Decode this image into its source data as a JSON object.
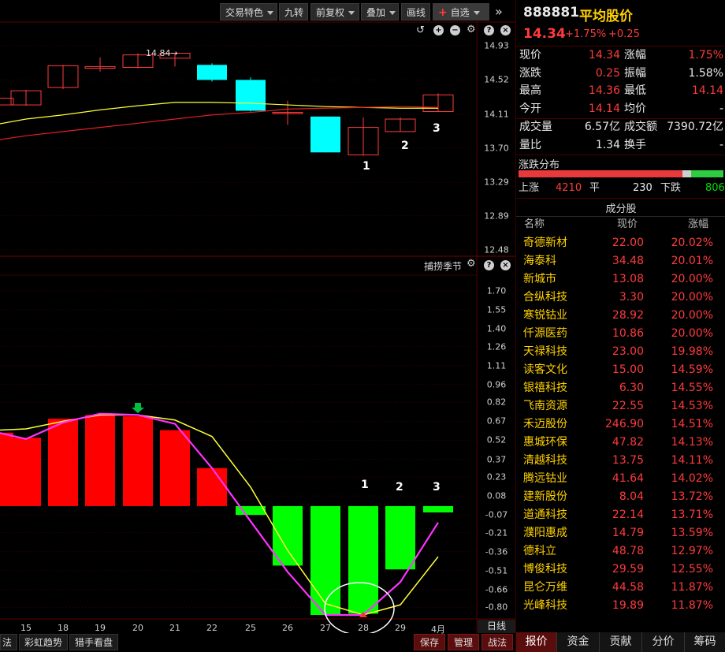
{
  "toolbar": {
    "items": [
      "交易特色",
      "九转",
      "前复权",
      "叠加",
      "画线",
      "自选"
    ],
    "more": "»"
  },
  "price_axis": [
    "14.93",
    "14.52",
    "14.11",
    "13.70",
    "13.29",
    "12.89",
    "12.48"
  ],
  "candle_annotation": "14.84→",
  "candle_markers": [
    "1",
    "2",
    "3"
  ],
  "indicator": {
    "title": "捕捞季节",
    "axis": [
      "1.70",
      "1.55",
      "1.40",
      "1.26",
      "1.11",
      "0.96",
      "0.82",
      "0.67",
      "0.52",
      "0.37",
      "0.23",
      "0.08",
      "-0.07",
      "-0.21",
      "-0.36",
      "-0.51",
      "-0.66",
      "-0.80"
    ],
    "markers": [
      "1",
      "2",
      "3"
    ]
  },
  "x_axis": [
    "15",
    "18",
    "19",
    "20",
    "21",
    "22",
    "25",
    "26",
    "27",
    "28",
    "29",
    "4月"
  ],
  "x_axis_right": "日线",
  "bottom_tabs": [
    "法",
    "彩虹趋势",
    "猎手看盘"
  ],
  "bottom_buttons": [
    "保存",
    "管理",
    "战法"
  ],
  "quote": {
    "code": "888881",
    "name": "平均股价",
    "price": "14.34",
    "change_pct": "+1.75%",
    "change": "+0.25",
    "rows": [
      {
        "l1": "现价",
        "v1": "14.34",
        "l2": "涨幅",
        "v2": "1.75%"
      },
      {
        "l1": "涨跌",
        "v1": "0.25",
        "l2": "振幅",
        "v2": "1.58%"
      },
      {
        "l1": "最高",
        "v1": "14.36",
        "l2": "最低",
        "v2": "14.14"
      },
      {
        "l1": "今开",
        "v1": "14.14",
        "l2": "均价",
        "v2": "-"
      }
    ],
    "rows2": [
      {
        "l1": "成交量",
        "v1": "6.57亿",
        "l2": "成交额",
        "v2": "7390.72亿"
      },
      {
        "l1": "量比",
        "v1": "1.34",
        "l2": "换手",
        "v2": "-"
      }
    ]
  },
  "distribution": {
    "title": "涨跌分布",
    "up_label": "上涨",
    "up": "4210",
    "flat_label": "平",
    "flat": "230",
    "down_label": "下跌",
    "down": "806",
    "up_ratio": 0.8,
    "flat_ratio": 0.044,
    "down_ratio": 0.156
  },
  "components": {
    "title": "成分股",
    "headers": [
      "名称",
      "现价",
      "涨幅"
    ],
    "rows": [
      [
        "奇德新材",
        "22.00",
        "20.02%"
      ],
      [
        "海泰科",
        "34.48",
        "20.01%"
      ],
      [
        "新城市",
        "13.08",
        "20.00%"
      ],
      [
        "合纵科技",
        "3.30",
        "20.00%"
      ],
      [
        "寒锐钴业",
        "28.92",
        "20.00%"
      ],
      [
        "仟源医药",
        "10.86",
        "20.00%"
      ],
      [
        "天禄科技",
        "23.00",
        "19.98%"
      ],
      [
        "读客文化",
        "15.00",
        "14.59%"
      ],
      [
        "银禧科技",
        "6.30",
        "14.55%"
      ],
      [
        "飞南资源",
        "22.55",
        "14.53%"
      ],
      [
        "禾迈股份",
        "246.90",
        "14.51%"
      ],
      [
        "惠城环保",
        "47.82",
        "14.13%"
      ],
      [
        "清越科技",
        "13.75",
        "14.11%"
      ],
      [
        "腾远钴业",
        "41.64",
        "14.02%"
      ],
      [
        "建新股份",
        "8.04",
        "13.72%"
      ],
      [
        "道通科技",
        "22.14",
        "13.71%"
      ],
      [
        "濮阳惠成",
        "14.79",
        "13.59%"
      ],
      [
        "德科立",
        "48.78",
        "12.97%"
      ],
      [
        "博俊科技",
        "29.59",
        "12.55%"
      ],
      [
        "昆仑万维",
        "44.58",
        "11.87%"
      ],
      [
        "光峰科技",
        "19.89",
        "11.87%"
      ]
    ]
  },
  "right_tabs": [
    "报价",
    "资金",
    "贡献",
    "分价",
    "筹码"
  ],
  "colors": {
    "up": "#ff3b3b",
    "down": "#00ffff",
    "bar_up": "#ff0000",
    "bar_down": "#00ff00",
    "ma_yellow": "#ffff33",
    "ma_red": "#e02020",
    "line_magenta": "#ff33ff"
  },
  "chart_data": [
    {
      "type": "candlestick",
      "categories": [
        "?",
        "15",
        "18",
        "19",
        "20",
        "21",
        "22",
        "25",
        "26",
        "27",
        "28",
        "29",
        "4月"
      ],
      "series": [
        {
          "values": [
            {
              "o": 14.22,
              "c": 14.3,
              "h": 14.32,
              "l": 14.2
            },
            {
              "o": 14.22,
              "c": 14.39,
              "h": 14.4,
              "l": 14.21
            },
            {
              "o": 14.43,
              "c": 14.69,
              "h": 14.7,
              "l": 14.41
            },
            {
              "o": 14.66,
              "c": 14.68,
              "h": 14.79,
              "l": 14.62
            },
            {
              "o": 14.67,
              "c": 14.82,
              "h": 14.84,
              "l": 14.66
            },
            {
              "o": 14.78,
              "c": 14.84,
              "h": 14.84,
              "l": 14.68
            },
            {
              "o": 14.7,
              "c": 14.52,
              "h": 14.72,
              "l": 14.5
            },
            {
              "o": 14.52,
              "c": 14.15,
              "h": 14.55,
              "l": 14.14
            },
            {
              "o": 14.13,
              "c": 14.13,
              "h": 14.27,
              "l": 13.98
            },
            {
              "o": 14.08,
              "c": 13.65,
              "h": 14.08,
              "l": 13.65
            },
            {
              "o": 13.62,
              "c": 13.95,
              "h": 14.07,
              "l": 13.61
            },
            {
              "o": 13.9,
              "c": 14.05,
              "h": 14.07,
              "l": 13.9
            },
            {
              "o": 14.14,
              "c": 14.34,
              "h": 14.36,
              "l": 14.14
            }
          ]
        },
        {
          "values": [
            13.99,
            14.05,
            14.1,
            14.16,
            14.21,
            14.25,
            14.25,
            14.24,
            14.22,
            14.2,
            14.19,
            14.18,
            14.18
          ]
        },
        {
          "values": [
            13.8,
            13.85,
            13.9,
            13.95,
            14.0,
            14.05,
            14.1,
            14.13,
            14.17,
            14.18,
            14.19,
            14.2,
            14.19
          ]
        }
      ],
      "ylim": [
        12.48,
        14.93
      ]
    },
    {
      "type": "bar",
      "title": "捕捞季节",
      "categories": [
        "?",
        "15",
        "18",
        "19",
        "20",
        "21",
        "22",
        "25",
        "26",
        "27",
        "28",
        "29",
        "4月"
      ],
      "values": [
        0.58,
        0.54,
        0.69,
        0.72,
        0.71,
        0.6,
        0.3,
        -0.07,
        -0.47,
        -0.86,
        -0.85,
        -0.5,
        -0.05
      ],
      "series": [
        {
          "values": [
            0.6,
            0.61,
            0.67,
            0.72,
            0.72,
            0.68,
            0.55,
            0.15,
            -0.35,
            -0.77,
            -0.86,
            -0.78,
            -0.4
          ]
        },
        {
          "values": [
            0.58,
            0.53,
            0.66,
            0.73,
            0.72,
            0.65,
            0.3,
            -0.12,
            -0.52,
            -0.86,
            -0.86,
            -0.6,
            -0.13
          ]
        }
      ],
      "ylim": [
        -0.86,
        1.7
      ]
    }
  ]
}
